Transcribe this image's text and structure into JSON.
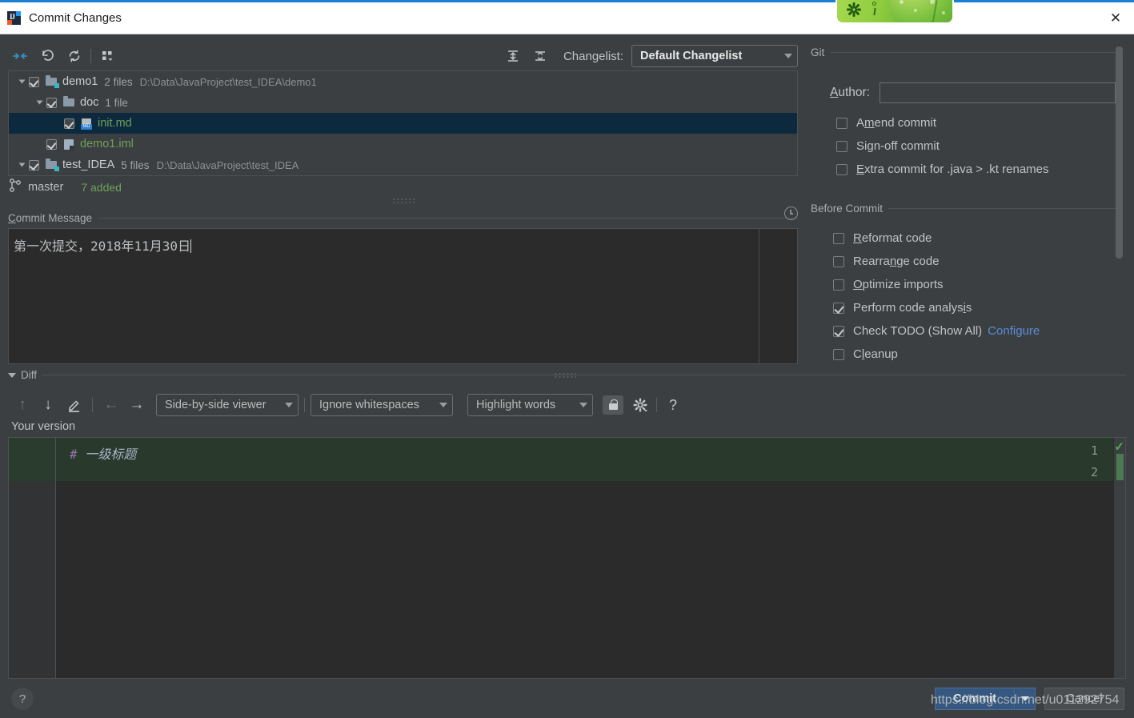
{
  "window": {
    "title": "Commit Changes",
    "app_icon": "intellij-idea-icon",
    "close_label": "✕"
  },
  "toolbar": {
    "show_diff_icon": "arrows-inward-icon",
    "revert_icon": "undo-arrow-icon",
    "refresh_icon": "refresh-icon",
    "group_by_icon": "group-by-icon",
    "expand_all_icon": "expand-all-icon",
    "collapse_all_icon": "collapse-all-icon",
    "changelist_label": "Changelist:",
    "changelist_value": "Default Changelist"
  },
  "tree": {
    "rows": [
      {
        "name": "demo1",
        "count": "2 files",
        "path": "D:\\Data\\JavaProject\\test_IDEA\\demo1",
        "indent": 0,
        "kind": "module",
        "expanded": true,
        "checked": true,
        "selected": false
      },
      {
        "name": "doc",
        "count": "1 file",
        "path": "",
        "indent": 1,
        "kind": "folder",
        "expanded": true,
        "checked": true,
        "selected": false
      },
      {
        "name": "init.md",
        "count": "",
        "path": "",
        "indent": 2,
        "kind": "markdown",
        "expanded": false,
        "checked": true,
        "selected": true
      },
      {
        "name": "demo1.iml",
        "count": "",
        "path": "",
        "indent": 1,
        "kind": "iml",
        "expanded": false,
        "checked": true,
        "selected": false
      },
      {
        "name": "test_IDEA",
        "count": "5 files",
        "path": "D:\\Data\\JavaProject\\test_IDEA",
        "indent": 0,
        "kind": "module",
        "expanded": true,
        "checked": true,
        "selected": false
      }
    ]
  },
  "branch": {
    "icon": "git-branch-icon",
    "name": "master",
    "status": "7 added"
  },
  "commit_message": {
    "section_label": "Commit Message",
    "mnemonic": "C",
    "rest": "ommit Message",
    "history_icon": "clock-icon",
    "value": "第一次提交，2018年11月30日",
    "placeholder": ""
  },
  "git_panel": {
    "section_label": "Git",
    "author_label_mnemonic": "A",
    "author_label_rest": "uthor:",
    "author_value": "",
    "author_placeholder": "",
    "checkboxes": [
      {
        "pre": "A",
        "mn": "m",
        "post": "end commit",
        "checked": false
      },
      {
        "pre": "Si",
        "mn": "g",
        "post": "n-off commit",
        "checked": false
      },
      {
        "pre": "",
        "mn": "E",
        "post": "xtra commit for .java > .kt renames",
        "checked": false
      }
    ]
  },
  "before_commit": {
    "section_label": "Before Commit",
    "checkboxes": [
      {
        "pre": "",
        "mn": "R",
        "post": "eformat code",
        "checked": false,
        "link": ""
      },
      {
        "pre": "Rearra",
        "mn": "n",
        "post": "ge code",
        "checked": false,
        "link": ""
      },
      {
        "pre": "",
        "mn": "O",
        "post": "ptimize imports",
        "checked": false,
        "link": ""
      },
      {
        "pre": "Perform code analys",
        "mn": "i",
        "post": "s",
        "checked": true,
        "link": ""
      },
      {
        "pre": "Check TODO (Show All)",
        "mn": "",
        "post": "",
        "checked": true,
        "link": "Configure"
      },
      {
        "pre": "C",
        "mn": "l",
        "post": "eanup",
        "checked": false,
        "link": ""
      }
    ]
  },
  "diff": {
    "section_label": "Diff",
    "expanded": true,
    "prev_change_icon": "arrow-up-icon",
    "next_change_icon": "arrow-down-icon",
    "edit_icon": "pencil-icon",
    "apply_left_icon": "arrow-left-icon",
    "apply_right_icon": "arrow-right-icon",
    "viewer_mode": "Side-by-side viewer",
    "whitespace_mode": "Ignore whitespaces",
    "highlight_mode": "Highlight words",
    "lock_icon": "lock-icon",
    "settings_icon": "gear-icon",
    "help_icon": "question-mark-icon",
    "pane_label": "Your version",
    "lines": [
      {
        "num": "1",
        "hash": "#",
        "text": "一级标题",
        "added": true
      },
      {
        "num": "2",
        "hash": "",
        "text": "",
        "added": true
      }
    ],
    "marker_check": "✓"
  },
  "footer": {
    "help_label": "?",
    "commit_label": "Commit",
    "commit_dropdown_icon": "chevron-down-icon",
    "cancel_label": "Cancel",
    "watermark": "https://blog.csdn.net/u011292754"
  },
  "ime_overlay": {
    "gear_icon": "gear-icon",
    "pen_icon": "handwriting-icon"
  },
  "colors": {
    "accent_blue": "#1a7fd4",
    "panel_bg": "#3c3f41",
    "editor_bg": "#2b2b2b",
    "selection": "#0d293e",
    "added_green": "#6ea05a",
    "diff_added_bg": "#29392c",
    "link_blue": "#598cd8",
    "commit_button": "#365880"
  }
}
